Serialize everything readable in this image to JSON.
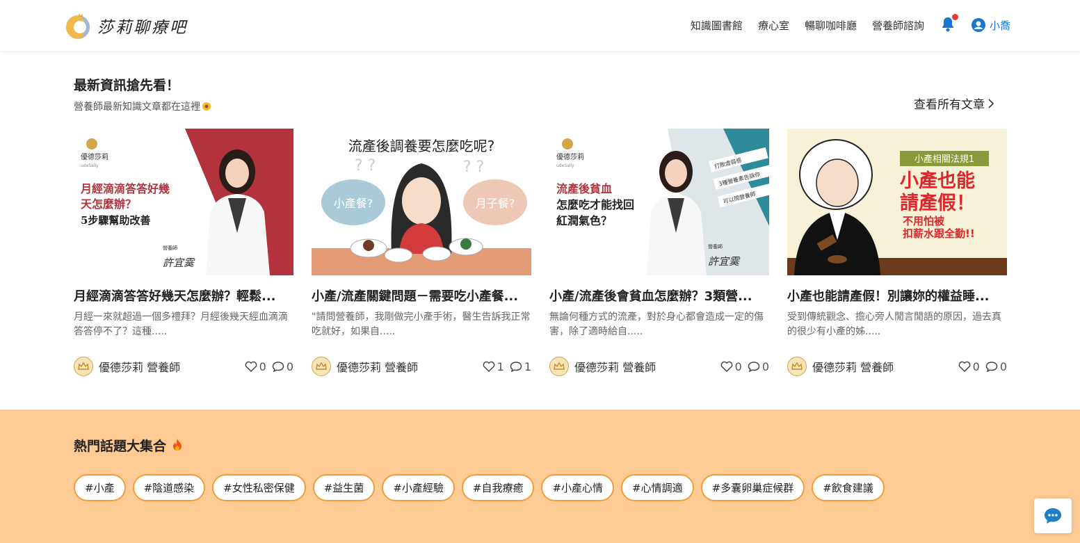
{
  "header": {
    "logo_text": "莎莉聊療吧",
    "nav": [
      "知識圖書館",
      "療心室",
      "暢聊咖啡廳",
      "營養師諮詢"
    ],
    "user_name": "小喬"
  },
  "articles": {
    "title": "最新資訊搶先看！",
    "subtitle": "營養師最新知識文章都在這裡",
    "see_all": "查看所有文章",
    "cards": [
      {
        "title": "月經滴滴答答好幾天怎麼辦？輕鬆...",
        "desc": "月經一來就超過一個多禮拜？月經後幾天經血滴滴答答停不了？這種.....",
        "author": "優德莎莉 營養師",
        "likes": "0",
        "comments": "0",
        "image": {
          "brand": "優德莎莉",
          "brand_sub": "udeSally",
          "headline_lines": [
            "月經滴滴答答好幾",
            "天怎麼辦？"
          ],
          "subline": "5步驟幫助改善",
          "role": "營養師",
          "signature": "許宜霙"
        }
      },
      {
        "title": "小產/流產關鍵問題－需要吃小產餐...",
        "desc": "\"請問營養師，我剛做完小產手術，醫生告訴我正常吃就好，如果自.....",
        "author": "優德莎莉 營養師",
        "likes": "1",
        "comments": "1",
        "image": {
          "headline": "流產後調養要怎麼吃呢?",
          "bubble_left": "小產餐?",
          "bubble_right": "月子餐?"
        }
      },
      {
        "title": "小產/流產後會貧血怎麼辦？3類營...",
        "desc": "無論何種方式的流產，對於身心都會造成一定的傷害，除了適時給自.....",
        "author": "優德莎莉 營養師",
        "likes": "0",
        "comments": "0",
        "image": {
          "brand": "優德莎莉",
          "brand_sub": "udeSally",
          "headline_lines": [
            "流產後貧血",
            "怎麼吃才能找回",
            "紅潤氣色？"
          ],
          "side_notes": [
            "打敗虛弱感",
            "3種營養素告訴你",
            "可以問營養師"
          ],
          "role": "營養師",
          "signature": "許宜霙"
        }
      },
      {
        "title": "小產也能請產假！別讓妳的權益睡...",
        "desc": "受到傳統觀念、擔心旁人閒言閒語的原因，過去真的很少有小產的姊.....",
        "author": "優德莎莉 營養師",
        "likes": "0",
        "comments": "0",
        "image": {
          "badge": "小產相關法規1",
          "headline_lines": [
            "小產也能",
            "請產假！"
          ],
          "sub_lines": [
            "不用怕被",
            "扣薪水跟全勤!!"
          ]
        }
      }
    ]
  },
  "topics": {
    "title": "熱門話題大集合",
    "tags": [
      "#小產",
      "#陰道感染",
      "#女性私密保健",
      "#益生菌",
      "#小產經驗",
      "#自我療癒",
      "#小產心情",
      "#心情調適",
      "#多囊卵巢症候群",
      "#飲食建議"
    ]
  },
  "colors": {
    "accent": "#f39c38",
    "topics_bg": "#ffcb94",
    "link_blue": "#1976d2",
    "card1_bg": "#b2333d",
    "card4_headline": "#e0262c"
  },
  "icons": [
    "logo-icon",
    "bell-icon",
    "user-circle-icon",
    "chevron-right-icon",
    "heart-icon",
    "comment-icon",
    "chat-icon",
    "crown-avatar-icon"
  ]
}
